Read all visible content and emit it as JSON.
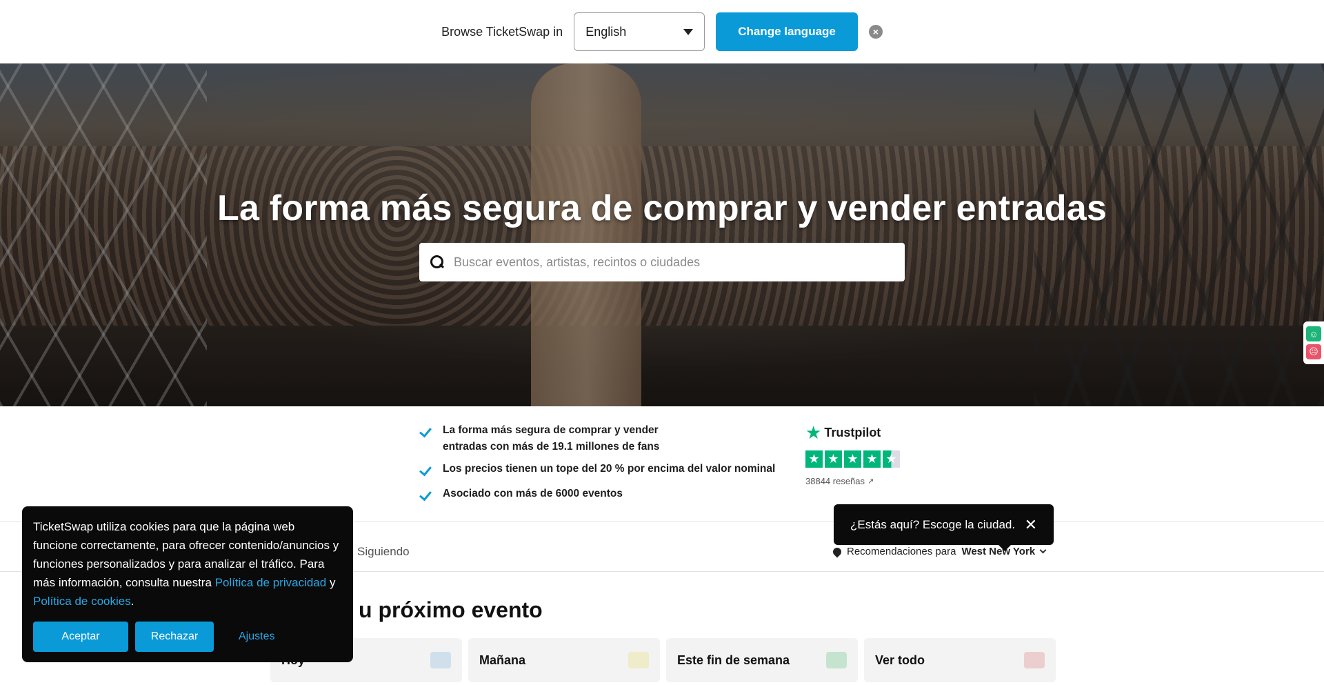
{
  "language_bar": {
    "browse_label": "Browse TicketSwap in",
    "selected_language": "English",
    "change_button": "Change language"
  },
  "hero": {
    "headline": "La forma más segura de comprar y vender entradas",
    "search_placeholder": "Buscar eventos, artistas, recintos o ciudades"
  },
  "usps": [
    "La forma más segura de comprar y vender entradas con más de 19.1 millones de fans",
    "Los precios tienen un tope del 20 % por encima del valor nominal",
    "Asociado con más de 6000 eventos"
  ],
  "trustpilot": {
    "name": "Trustpilot",
    "rating": 4.5,
    "reviews": "38844 reseñas"
  },
  "tabs": {
    "following": "Siguiendo"
  },
  "location": {
    "prefix": "Recomendaciones para",
    "city": "West New York"
  },
  "city_tooltip": {
    "text": "¿Estás aquí? Escoge la ciudad."
  },
  "section": {
    "title": "u próximo evento"
  },
  "date_chips": [
    {
      "label": "Hoy",
      "color": "#8fb9e0"
    },
    {
      "label": "Mañana",
      "color": "#e6e07a"
    },
    {
      "label": "Este fin de semana",
      "color": "#6ec98c"
    },
    {
      "label": "Ver todo",
      "color": "#e08a8a"
    }
  ],
  "cookie": {
    "text_before": "TicketSwap utiliza cookies para que la página web funcione correctamente, para ofrecer contenido/anuncios y funciones personalizados y para analizar el tráfico. Para más información, consulta nuestra ",
    "privacy_link": "Política de privacidad",
    "conjunction": " y ",
    "cookies_link": "Política de cookies",
    "period": ".",
    "accept": "Aceptar",
    "reject": "Rechazar",
    "settings": "Ajustes"
  },
  "colors": {
    "accent": "#0a9ad8",
    "trustpilot_green": "#00b67a",
    "cookie_bg": "#0a0a0a"
  }
}
